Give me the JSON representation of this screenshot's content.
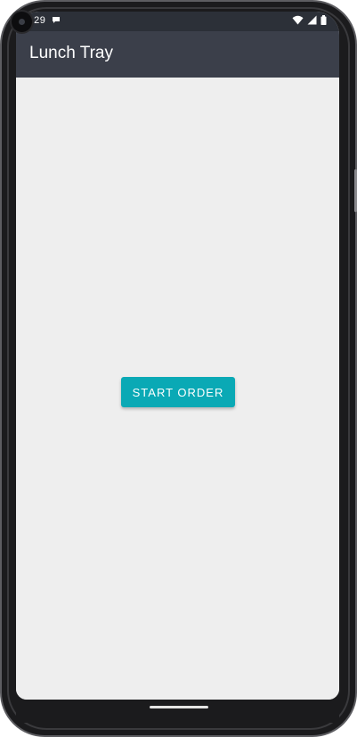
{
  "status_bar": {
    "time": "7:29",
    "icons": [
      "message-icon",
      "wifi-icon",
      "signal-icon",
      "battery-icon"
    ]
  },
  "app_bar": {
    "title": "Lunch Tray",
    "background_color": "#3b3f4a"
  },
  "main": {
    "start_button_label": "START ORDER",
    "button_color": "#0aa9b5",
    "background_color": "#eeeeee"
  }
}
